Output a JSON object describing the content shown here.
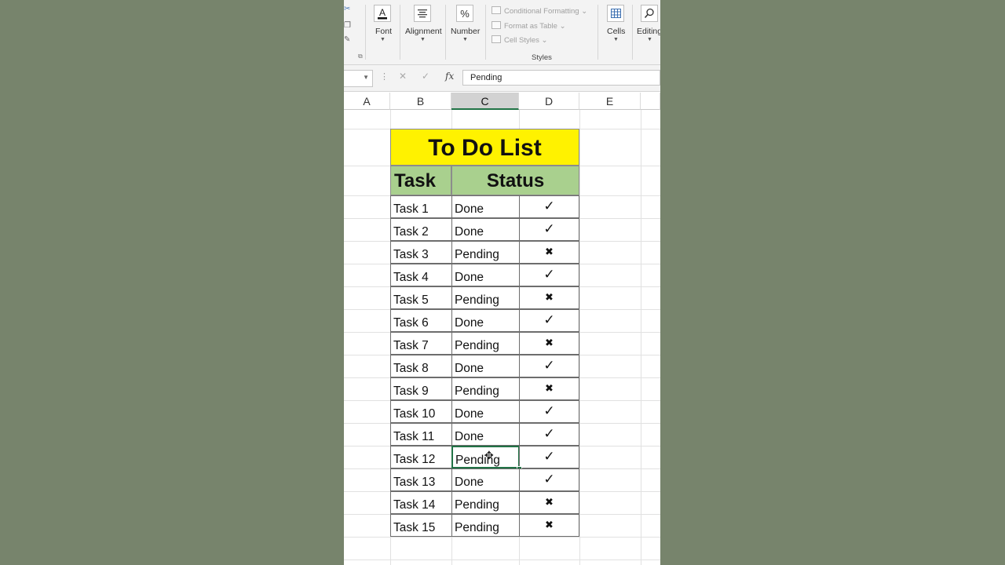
{
  "ribbon": {
    "font_label": "Font",
    "font_icon": "font-color-icon",
    "alignment_label": "Alignment",
    "alignment_icon": "align-lines-icon",
    "number_label": "Number",
    "number_symbol": "%",
    "styles": {
      "conditional_formatting": "Conditional Formatting",
      "format_as_table": "Format as Table",
      "cell_styles": "Cell Styles",
      "group_label": "Styles"
    },
    "cells_label": "Cells",
    "editing_label": "Editing"
  },
  "formula_bar": {
    "cancel_symbol": "✕",
    "enter_symbol": "✓",
    "fx_label": "fx",
    "value": "Pending"
  },
  "columns": [
    "A",
    "B",
    "C",
    "D",
    "E"
  ],
  "selected_column": "C",
  "sheet": {
    "title": "To Do List",
    "header_task": "Task",
    "header_status": "Status",
    "rows": [
      {
        "task": "Task 1",
        "status": "Done",
        "mark": "✓"
      },
      {
        "task": "Task 2",
        "status": "Done",
        "mark": "✓"
      },
      {
        "task": "Task 3",
        "status": "Pending",
        "mark": "✖"
      },
      {
        "task": "Task 4",
        "status": "Done",
        "mark": "✓"
      },
      {
        "task": "Task 5",
        "status": "Pending",
        "mark": "✖"
      },
      {
        "task": "Task 6",
        "status": "Done",
        "mark": "✓"
      },
      {
        "task": "Task 7",
        "status": "Pending",
        "mark": "✖"
      },
      {
        "task": "Task 8",
        "status": "Done",
        "mark": "✓"
      },
      {
        "task": "Task 9",
        "status": "Pending",
        "mark": "✖"
      },
      {
        "task": "Task 10",
        "status": "Done",
        "mark": "✓"
      },
      {
        "task": "Task 11",
        "status": "Done",
        "mark": "✓"
      },
      {
        "task": "Task 12",
        "status": "Pending",
        "mark": "✓"
      },
      {
        "task": "Task 13",
        "status": "Done",
        "mark": "✓"
      },
      {
        "task": "Task 14",
        "status": "Pending",
        "mark": "✖"
      },
      {
        "task": "Task 15",
        "status": "Pending",
        "mark": "✖"
      }
    ],
    "active_row_index": 11
  },
  "colors": {
    "title_fill": "#fff200",
    "header_fill": "#a9d08e",
    "excel_green": "#217346"
  }
}
